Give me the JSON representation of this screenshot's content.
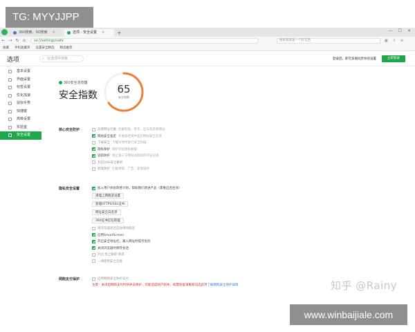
{
  "watermarks": {
    "top": "TG: MYYJJPP",
    "bottom": "www.winbaijiale.com",
    "zhihu": "知乎 @Rainy"
  },
  "browser": {
    "tabs": [
      {
        "label": "360搜索，SO搜索"
      },
      {
        "label": "选项 - 安全设置"
      }
    ],
    "url": "se://settings/safe",
    "search_placeholder": "搜索看看第一个好东西",
    "bookmarks": [
      "收藏",
      "手机收藏夹",
      "设置安全精选",
      "精选推荐"
    ]
  },
  "header": {
    "title": "选项",
    "search_placeholder": "在选项中搜索",
    "login_hint": "登录后，即可多端同步你的设置",
    "login_button": "立即登录"
  },
  "sidebar": {
    "items": [
      {
        "label": "基本设置"
      },
      {
        "label": "界面设置"
      },
      {
        "label": "标签设置"
      },
      {
        "label": "优化加速"
      },
      {
        "label": "鼠标手势"
      },
      {
        "label": "快捷键"
      },
      {
        "label": "高级设置"
      },
      {
        "label": "实验室"
      },
      {
        "label": "安全设置"
      }
    ],
    "active_index": 8
  },
  "main": {
    "shield_label": "360安全浏览器",
    "title": "安全指数",
    "score": "65",
    "score_sub": "安全指数",
    "score_fraction": 0.65,
    "sections": {
      "core": {
        "title": "核心安全防护",
        "options": [
          {
            "label": "恶意网址拦截",
            "desc": "拦截钓鱼、欺诈、挂马等恶意网址",
            "checked": false
          },
          {
            "label": "网站安全鉴定",
            "desc": "在搜索结果中显示网站安全信息",
            "checked": true
          },
          {
            "label": "下载安全",
            "desc": "下载文件时进行安全扫描",
            "checked": false
          },
          {
            "label": "隐私保护",
            "desc": "保护浏览隐私数据",
            "checked": true
          },
          {
            "label": "追踪防护",
            "desc": "阻止第三方网站追踪您的浏览记录",
            "checked": true
          },
          {
            "label": "开启DNS安全解析",
            "desc": "",
            "checked": false
          },
          {
            "label": "智能防护",
            "desc": "拦截弹窗、广告、恶意插件",
            "checked": false
          }
        ]
      },
      "certs": {
        "title": "隐私安全设置",
        "top_option": "加入用户体验改善计划，帮助我们改进产品（需重启后生效）",
        "buttons": [
          "清理上网痕迹设置",
          "管理HTTPS/SSL证书",
          "网址安全白名单",
          "360证书信任管理"
        ],
        "options": [
          {
            "label": "随浏览器退出自动清除痕迹",
            "checked": false
          },
          {
            "label": "启用SmartScreen",
            "checked": true
          },
          {
            "label": "开启安全地址栏，输入网址时提示危险",
            "checked": true
          },
          {
            "label": "关闭浏览器时保存会话",
            "checked": true
          },
          {
            "label": "开启'禁止跟踪'请求",
            "checked": false
          },
          {
            "label": "一律使用安全连接",
            "checked": false
          }
        ]
      },
      "payment": {
        "title": "网购支付保护",
        "option": "启用网购安全防护支付",
        "warning": "注意：关闭后网购支付时将失去保护，可能造成财产损失，如需恢复请重新勾选此项",
        "warning_link": "了解网购安全保护详情"
      }
    }
  },
  "colors": {
    "accent": "#1ea84a",
    "gauge_arc": "#e8803a",
    "warning": "#d03030"
  }
}
